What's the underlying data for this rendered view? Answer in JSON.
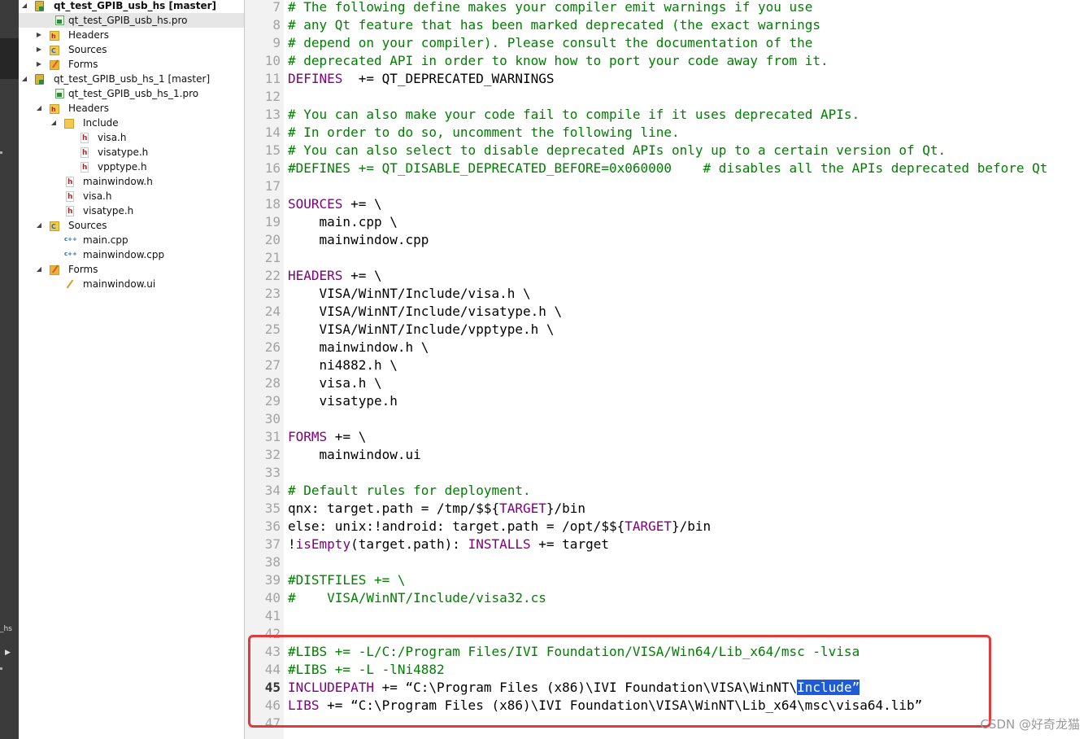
{
  "tree": {
    "nodes": [
      {
        "id": "n0",
        "label": "qt_test_GPIB_usb_hs [master]",
        "bold": true,
        "icon": "project-icon",
        "twisty": "open"
      },
      {
        "id": "n1",
        "label": "qt_test_GPIB_usb_hs.pro",
        "icon": "pro-file-icon",
        "selected": true
      },
      {
        "id": "n2",
        "label": "Headers",
        "icon": "headers-folder-icon",
        "twisty": "closed"
      },
      {
        "id": "n3",
        "label": "Sources",
        "icon": "sources-folder-icon",
        "twisty": "closed"
      },
      {
        "id": "n4",
        "label": "Forms",
        "icon": "forms-folder-icon",
        "twisty": "closed"
      },
      {
        "id": "n5",
        "label": "qt_test_GPIB_usb_hs_1 [master]",
        "icon": "project-icon",
        "twisty": "open"
      },
      {
        "id": "n6",
        "label": "qt_test_GPIB_usb_hs_1.pro",
        "icon": "pro-file-icon"
      },
      {
        "id": "n7",
        "label": "Headers",
        "icon": "headers-folder-icon",
        "twisty": "open"
      },
      {
        "id": "n8",
        "label": "Include",
        "icon": "folder-icon",
        "twisty": "open"
      },
      {
        "id": "n9",
        "label": "visa.h",
        "icon": "header-file-icon"
      },
      {
        "id": "n10",
        "label": "visatype.h",
        "icon": "header-file-icon"
      },
      {
        "id": "n11",
        "label": "vpptype.h",
        "icon": "header-file-icon"
      },
      {
        "id": "n12",
        "label": "mainwindow.h",
        "icon": "header-file-icon"
      },
      {
        "id": "n13",
        "label": "visa.h",
        "icon": "header-file-icon"
      },
      {
        "id": "n14",
        "label": "visatype.h",
        "icon": "header-file-icon"
      },
      {
        "id": "n15",
        "label": "Sources",
        "icon": "sources-folder-icon",
        "twisty": "open"
      },
      {
        "id": "n16",
        "label": "main.cpp",
        "icon": "cpp-file-icon"
      },
      {
        "id": "n17",
        "label": "mainwindow.cpp",
        "icon": "cpp-file-icon"
      },
      {
        "id": "n18",
        "label": "Forms",
        "icon": "forms-folder-icon",
        "twisty": "open"
      },
      {
        "id": "n19",
        "label": "mainwindow.ui",
        "icon": "ui-file-icon"
      }
    ]
  },
  "sidebar": {
    "truncated_label": "_hs"
  },
  "editor": {
    "current_line": "45",
    "lines": [
      {
        "n": "7",
        "t": [
          [
            "cm",
            "# The following define makes your compiler emit warnings if you use"
          ]
        ]
      },
      {
        "n": "8",
        "t": [
          [
            "cm",
            "# any Qt feature that has been marked deprecated (the exact warnings"
          ]
        ]
      },
      {
        "n": "9",
        "t": [
          [
            "cm",
            "# depend on your compiler). Please consult the documentation of the"
          ]
        ]
      },
      {
        "n": "10",
        "t": [
          [
            "cm",
            "# deprecated API in order to know how to port your code away from it."
          ]
        ]
      },
      {
        "n": "11",
        "t": [
          [
            "kw",
            "DEFINES"
          ],
          [
            "",
            "  += QT_DEPRECATED_WARNINGS"
          ]
        ]
      },
      {
        "n": "12",
        "t": []
      },
      {
        "n": "13",
        "t": [
          [
            "cm",
            "# You can also make your code fail to compile if it uses deprecated APIs."
          ]
        ]
      },
      {
        "n": "14",
        "t": [
          [
            "cm",
            "# In order to do so, uncomment the following line."
          ]
        ]
      },
      {
        "n": "15",
        "t": [
          [
            "cm",
            "# You can also select to disable deprecated APIs only up to a certain version of Qt."
          ]
        ]
      },
      {
        "n": "16",
        "t": [
          [
            "cm",
            "#DEFINES += QT_DISABLE_DEPRECATED_BEFORE=0x060000    # disables all the APIs deprecated before Qt"
          ]
        ]
      },
      {
        "n": "17",
        "t": []
      },
      {
        "n": "18",
        "t": [
          [
            "kw",
            "SOURCES"
          ],
          [
            "",
            " += \\"
          ]
        ]
      },
      {
        "n": "19",
        "t": [
          [
            "",
            "    main.cpp \\"
          ]
        ]
      },
      {
        "n": "20",
        "t": [
          [
            "",
            "    mainwindow.cpp"
          ]
        ]
      },
      {
        "n": "21",
        "t": []
      },
      {
        "n": "22",
        "t": [
          [
            "kw",
            "HEADERS"
          ],
          [
            "",
            " += \\"
          ]
        ]
      },
      {
        "n": "23",
        "t": [
          [
            "",
            "    VISA/WinNT/Include/visa.h \\"
          ]
        ]
      },
      {
        "n": "24",
        "t": [
          [
            "",
            "    VISA/WinNT/Include/visatype.h \\"
          ]
        ]
      },
      {
        "n": "25",
        "t": [
          [
            "",
            "    VISA/WinNT/Include/vpptype.h \\"
          ]
        ]
      },
      {
        "n": "26",
        "t": [
          [
            "",
            "    mainwindow.h \\"
          ]
        ]
      },
      {
        "n": "27",
        "t": [
          [
            "",
            "    ni4882.h \\"
          ]
        ]
      },
      {
        "n": "28",
        "t": [
          [
            "",
            "    visa.h \\"
          ]
        ]
      },
      {
        "n": "29",
        "t": [
          [
            "",
            "    visatype.h"
          ]
        ]
      },
      {
        "n": "30",
        "t": []
      },
      {
        "n": "31",
        "t": [
          [
            "kw",
            "FORMS"
          ],
          [
            "",
            " += \\"
          ]
        ]
      },
      {
        "n": "32",
        "t": [
          [
            "",
            "    mainwindow.ui"
          ]
        ]
      },
      {
        "n": "33",
        "t": []
      },
      {
        "n": "34",
        "t": [
          [
            "cm",
            "# Default rules for deployment."
          ]
        ]
      },
      {
        "n": "35",
        "t": [
          [
            "",
            "qnx: target.path = /tmp/$${"
          ],
          [
            "kw",
            "TARGET"
          ],
          [
            "",
            "}/bin"
          ]
        ]
      },
      {
        "n": "36",
        "t": [
          [
            "",
            "else: unix:!android: target.path = /opt/$${"
          ],
          [
            "kw",
            "TARGET"
          ],
          [
            "",
            "}/bin"
          ]
        ]
      },
      {
        "n": "37",
        "t": [
          [
            "",
            "!"
          ],
          [
            "fn",
            "isEmpty"
          ],
          [
            "",
            "(target.path): "
          ],
          [
            "kw",
            "INSTALLS"
          ],
          [
            "",
            " += target"
          ]
        ]
      },
      {
        "n": "38",
        "t": []
      },
      {
        "n": "39",
        "t": [
          [
            "cm",
            "#DISTFILES += \\"
          ]
        ]
      },
      {
        "n": "40",
        "t": [
          [
            "cm",
            "#    VISA/WinNT/Include/visa32.cs"
          ]
        ]
      },
      {
        "n": "41",
        "t": []
      },
      {
        "n": "42",
        "t": []
      },
      {
        "n": "43",
        "t": [
          [
            "cm",
            "#LIBS += -L/C:/Program Files/IVI Foundation/VISA/Win64/Lib_x64/msc -lvisa"
          ]
        ]
      },
      {
        "n": "44",
        "t": [
          [
            "cm",
            "#LIBS += -L -lNi4882"
          ]
        ]
      },
      {
        "n": "45",
        "t": [
          [
            "kw",
            "INCLUDEPATH"
          ],
          [
            "",
            " += “C:\\Program Files (x86)\\IVI Foundation\\VISA\\WinNT\\"
          ],
          [
            "sel-hl",
            "Include”"
          ]
        ]
      },
      {
        "n": "46",
        "t": [
          [
            "kw",
            "LIBS"
          ],
          [
            "",
            " += “C:\\Program Files (x86)\\IVI Foundation\\VISA\\WinNT\\Lib_x64\\msc\\visa64.lib”"
          ]
        ]
      },
      {
        "n": "47",
        "t": []
      }
    ]
  },
  "watermark": "CSDN @好奇龙猫",
  "colors": {
    "comment": "#008000",
    "keyword": "#800080",
    "selection": "#1e5bd6",
    "annotation_box": "#e03a3a"
  }
}
